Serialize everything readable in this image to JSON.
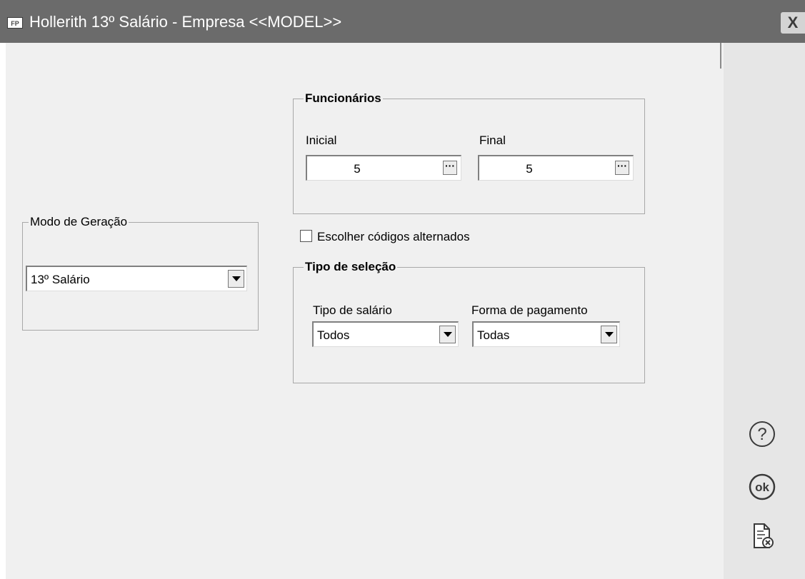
{
  "window": {
    "app_icon": "FP",
    "title": "Hollerith 13º Salário - Empresa <<MODEL>>",
    "close": "X"
  },
  "modo_geracao": {
    "legend": "Modo de Geração",
    "selected": "13º Salário"
  },
  "funcionarios": {
    "legend": "Funcionários",
    "inicial_label": "Inicial",
    "inicial_value": "5",
    "final_label": "Final",
    "final_value": "5",
    "browse": "···"
  },
  "alternados": {
    "label": "Escolher códigos alternados",
    "checked": false
  },
  "tipo_selecao": {
    "legend": "Tipo de seleção",
    "tipo_salario_label": "Tipo de salário",
    "tipo_salario_value": "Todos",
    "forma_pagamento_label": "Forma de pagamento",
    "forma_pagamento_value": "Todas"
  },
  "side_buttons": [
    {
      "name": "help",
      "icon": "question-circle-icon"
    },
    {
      "name": "ok",
      "icon": "ok-circle-icon",
      "text": "ok"
    },
    {
      "name": "cancel",
      "icon": "document-cancel-icon"
    }
  ]
}
